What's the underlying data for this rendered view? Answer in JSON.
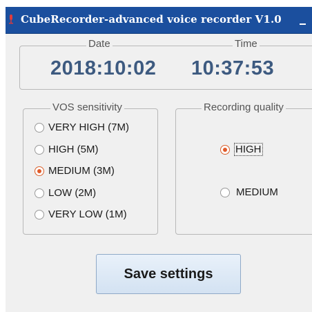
{
  "window": {
    "title": "CubeRecorder-advanced voice recorder V1.0",
    "title_bar_color": "#1b4f9e",
    "icon": "app-icon"
  },
  "datetime": {
    "date_label": "Date",
    "time_label": "Time",
    "date_value": "2018:10:02",
    "time_value": "10:37:53",
    "value_color": "#3d5a80"
  },
  "vos": {
    "legend": "VOS sensitivity",
    "options": [
      {
        "label": "VERY HIGH (7M)",
        "checked": false
      },
      {
        "label": "HIGH (5M)",
        "checked": false
      },
      {
        "label": "MEDIUM (3M)",
        "checked": true
      },
      {
        "label": "LOW (2M)",
        "checked": false
      },
      {
        "label": "VERY LOW (1M)",
        "checked": false
      }
    ]
  },
  "quality": {
    "legend": "Recording quality",
    "options": [
      {
        "label": "HIGH",
        "checked": true
      },
      {
        "label": "MEDIUM",
        "checked": false
      }
    ]
  },
  "save_button": {
    "label": "Save settings"
  },
  "colors": {
    "radio_selected": "#e05a2a",
    "window_background": "#f0f0f0"
  }
}
